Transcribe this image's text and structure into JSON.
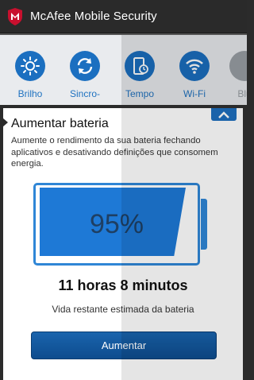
{
  "app": {
    "title": "McAfee Mobile Security"
  },
  "quick_settings": [
    {
      "label": "Brilho",
      "icon": "brightness-icon"
    },
    {
      "label": "Sincro-",
      "icon": "sync-icon"
    },
    {
      "label": "Tempo",
      "icon": "screen-timeout-icon"
    },
    {
      "label": "Wi-Fi",
      "icon": "wifi-icon"
    },
    {
      "label": "Blu",
      "icon": "bluetooth-icon"
    }
  ],
  "panel": {
    "title": "Aumentar bateria",
    "description": "Aumente o rendimento da sua bateria fechando aplicativos e desativando definições que consomem energia.",
    "battery_percent_label": "95%",
    "battery_level": 0.95,
    "time_left": "11 horas 8 minutos",
    "time_caption": "Vida restante estimada da bateria",
    "button_label": "Aumentar"
  },
  "colors": {
    "accent": "#1e79d6",
    "titlebar": "#2a2a2a",
    "button": "#0d4c8e"
  }
}
